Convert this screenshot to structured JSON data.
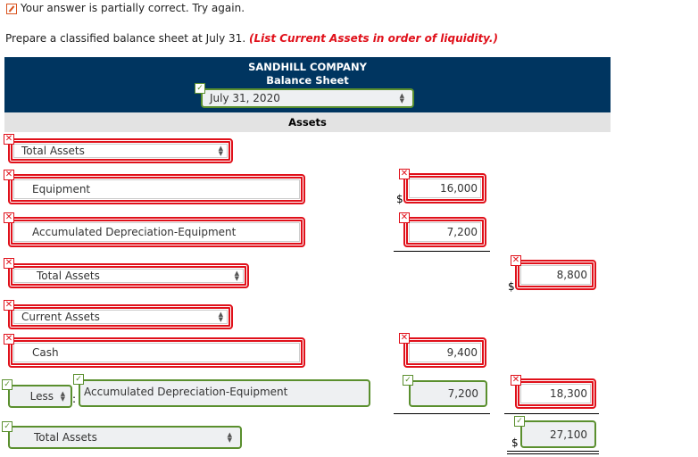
{
  "status": {
    "icon": "pencil-icon",
    "text": "Your answer is partially correct.  Try again."
  },
  "instructions": {
    "text": "Prepare a classified balance sheet at July 31. ",
    "highlight": "(List Current Assets in order of liquidity.)"
  },
  "header": {
    "company": "SANDHILL COMPANY",
    "statement": "Balance Sheet",
    "date_value": "July 31, 2020",
    "date_status": "correct",
    "section": "Assets"
  },
  "rows": [
    {
      "label": "Total Assets",
      "type": "select",
      "status": "incorrect"
    },
    {
      "label": "Equipment",
      "type": "text",
      "status": "incorrect",
      "amount": "16,000",
      "amount_status": "incorrect",
      "dollar": "$"
    },
    {
      "label": "Accumulated Depreciation-Equipment",
      "type": "text",
      "status": "incorrect",
      "amount": "7,200",
      "amount_status": "incorrect"
    },
    {
      "label": "Total Assets",
      "type": "select",
      "status": "incorrect",
      "total": "8,800",
      "total_status": "incorrect",
      "dollar": "$"
    },
    {
      "label": "Current Assets",
      "type": "select",
      "status": "incorrect"
    },
    {
      "label": "Cash",
      "type": "text",
      "status": "incorrect",
      "amount": "9,400",
      "amount_status": "incorrect"
    },
    {
      "prefix": "Less",
      "separator": ":",
      "label": "Accumulated Depreciation-Equipment",
      "type": "text",
      "status": "correct",
      "amount": "7,200",
      "amount_status": "correct",
      "total": "18,300",
      "total_status": "incorrect"
    },
    {
      "label": "Total Assets",
      "type": "select",
      "status": "correct",
      "total": "27,100",
      "total_status": "correct",
      "dollar": "$"
    }
  ],
  "colors": {
    "header_bg": "#003560",
    "section_bg": "#e3e3e3",
    "incorrect": "#e0101a",
    "correct": "#5a8f2e",
    "instruction_highlight": "#e0101a"
  }
}
